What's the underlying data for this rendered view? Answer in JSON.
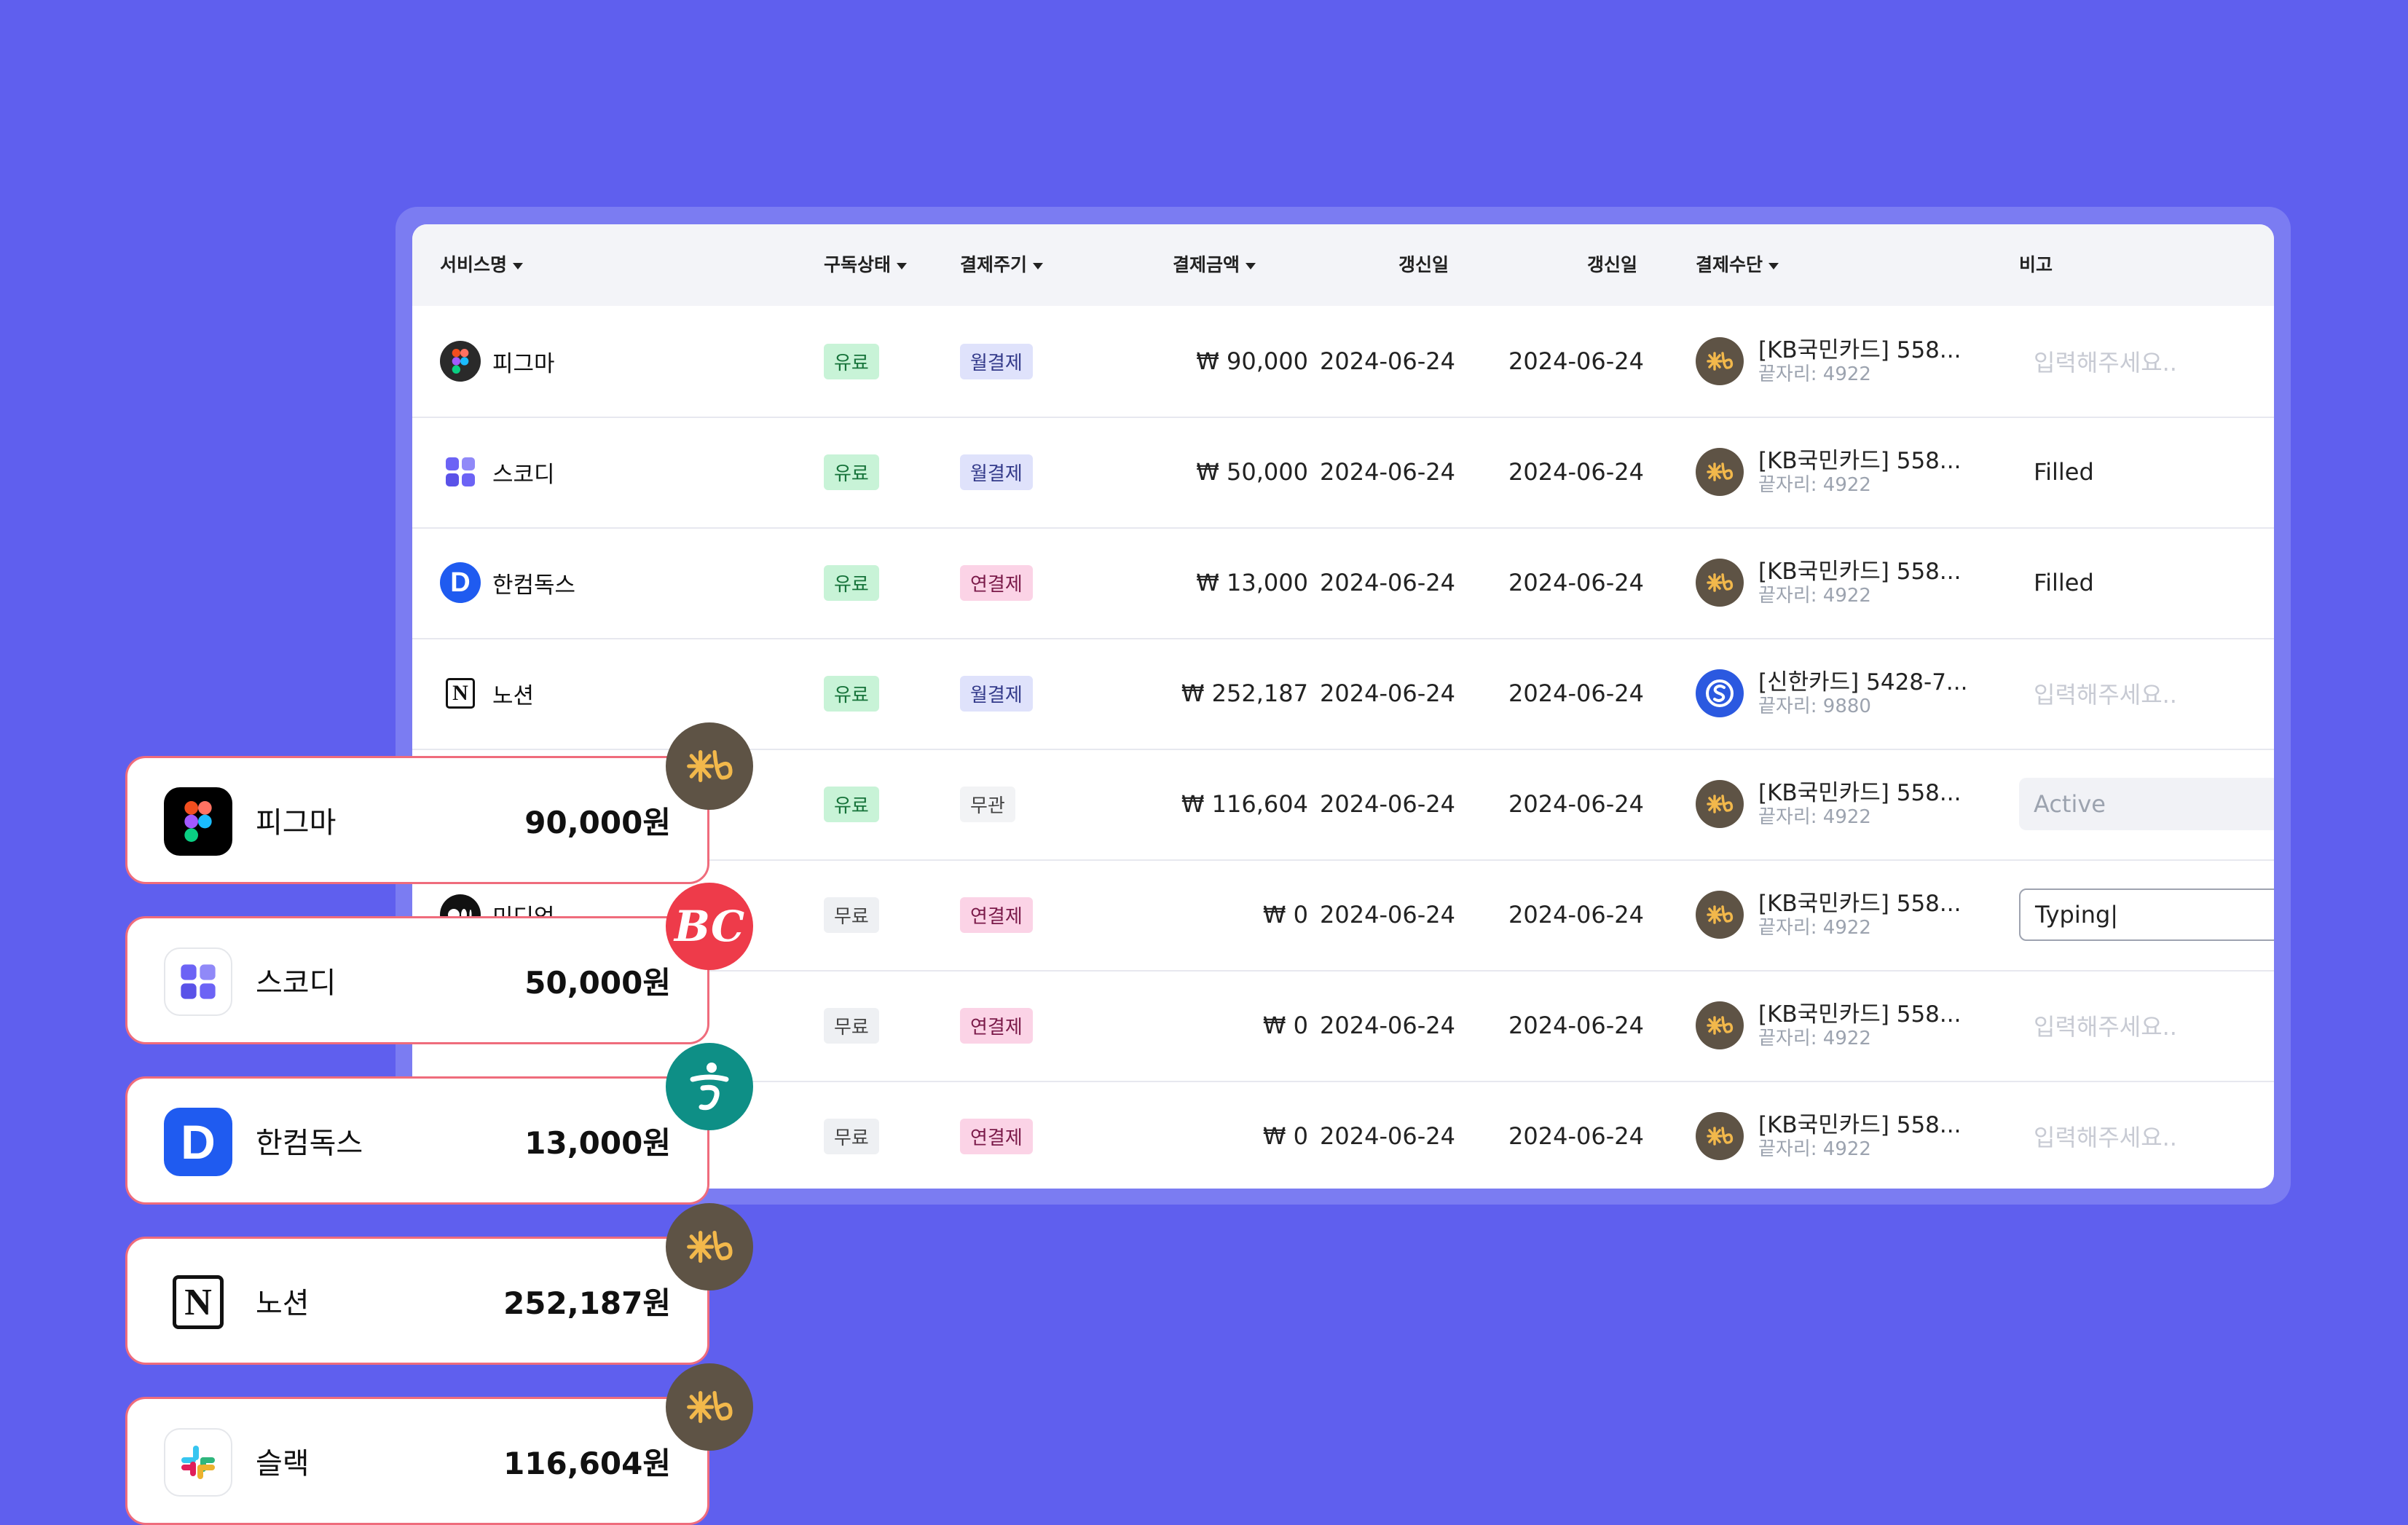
{
  "table": {
    "headers": {
      "service": "서비스명",
      "status": "구독상태",
      "cycle": "결제주기",
      "amount": "결제금액",
      "renew1": "갱신일",
      "renew2": "갱신일",
      "payment": "결제수단",
      "memo": "비고"
    },
    "rows": [
      {
        "name": "피그마",
        "icon": "figma-icon",
        "status": "유료",
        "cycle": "월결제",
        "amount": "₩ 90,000",
        "renew1": "2024-06-24",
        "renew2": "2024-06-24",
        "card": "[KB국민카드] 558...",
        "card_sub": "끝자리: 4922",
        "card_icon": "kb-card-icon",
        "memo": "입력해주세요.."
      },
      {
        "name": "스코디",
        "icon": "scody-icon",
        "status": "유료",
        "cycle": "월결제",
        "amount": "₩ 50,000",
        "renew1": "2024-06-24",
        "renew2": "2024-06-24",
        "card": "[KB국민카드] 558...",
        "card_sub": "끝자리: 4922",
        "card_icon": "kb-card-icon",
        "memo": "Filled"
      },
      {
        "name": "한컴독스",
        "icon": "hancomdocs-icon",
        "status": "유료",
        "cycle": "연결제",
        "amount": "₩ 13,000",
        "renew1": "2024-06-24",
        "renew2": "2024-06-24",
        "card": "[KB국민카드] 558...",
        "card_sub": "끝자리: 4922",
        "card_icon": "kb-card-icon",
        "memo": "Filled"
      },
      {
        "name": "노션",
        "icon": "notion-icon",
        "status": "유료",
        "cycle": "월결제",
        "amount": "₩ 252,187",
        "renew1": "2024-06-24",
        "renew2": "2024-06-24",
        "card": "[신한카드] 5428-7...",
        "card_sub": "끝자리: 9880",
        "card_icon": "shinhan-card-icon",
        "memo": "입력해주세요.."
      },
      {
        "name": "",
        "icon": "",
        "status": "유료",
        "cycle": "무관",
        "amount": "₩ 116,604",
        "renew1": "2024-06-24",
        "renew2": "2024-06-24",
        "card": "[KB국민카드] 558...",
        "card_sub": "끝자리: 4922",
        "card_icon": "kb-card-icon",
        "memo": "Active"
      },
      {
        "name": "미디엄",
        "icon": "medium-icon",
        "status": "무료",
        "cycle": "연결제",
        "amount": "₩ 0",
        "renew1": "2024-06-24",
        "renew2": "2024-06-24",
        "card": "[KB국민카드] 558...",
        "card_sub": "끝자리: 4922",
        "card_icon": "kb-card-icon",
        "memo": "Typing|"
      },
      {
        "name": "",
        "icon": "",
        "status": "무료",
        "cycle": "연결제",
        "amount": "₩ 0",
        "renew1": "2024-06-24",
        "renew2": "2024-06-24",
        "card": "[KB국민카드] 558...",
        "card_sub": "끝자리: 4922",
        "card_icon": "kb-card-icon",
        "memo": "입력해주세요.."
      },
      {
        "name": "",
        "icon": "",
        "status": "무료",
        "cycle": "연결제",
        "amount": "₩ 0",
        "renew1": "2024-06-24",
        "renew2": "2024-06-24",
        "card": "[KB국민카드] 558...",
        "card_sub": "끝자리: 4922",
        "card_icon": "kb-card-icon",
        "memo": "입력해주세요.."
      }
    ]
  },
  "cards": [
    {
      "name": "피그마",
      "amount": "90,000원",
      "icon": "figma-icon",
      "badge": "kb-card-icon"
    },
    {
      "name": "스코디",
      "amount": "50,000원",
      "icon": "scody-icon",
      "badge": "bc-card-icon"
    },
    {
      "name": "한컴독스",
      "amount": "13,000원",
      "icon": "hancomdocs-icon",
      "badge": "hana-card-icon"
    },
    {
      "name": "노션",
      "amount": "252,187원",
      "icon": "notion-icon",
      "badge": "kb-card-icon"
    },
    {
      "name": "슬랙",
      "amount": "116,604원",
      "icon": "slack-icon",
      "badge": "kb-card-icon"
    }
  ],
  "colors": {
    "background": "#5f5fee",
    "card_border": "#ef6c7c",
    "kb": "#5e5345",
    "kb_star": "#f2b84b",
    "bc": "#ee3b4a",
    "hana": "#0e8f86",
    "shinhan": "#2b59e0"
  },
  "badges": {
    "bc": "BC"
  },
  "logos": {
    "hancom": "D",
    "notion": "N"
  }
}
